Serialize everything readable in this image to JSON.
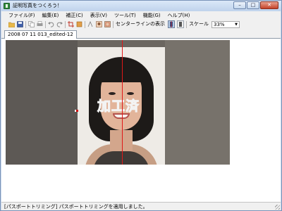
{
  "window": {
    "title": "証明写真をつくろう！",
    "controls": {
      "minimize": "–",
      "maximize": "□",
      "close": "✕"
    }
  },
  "menu": [
    {
      "label": "ファイル(F)"
    },
    {
      "label": "編集(E)"
    },
    {
      "label": "補正(C)"
    },
    {
      "label": "表示(V)"
    },
    {
      "label": "ツール(T)"
    },
    {
      "label": "機能(G)"
    },
    {
      "label": "ヘルプ(H)"
    }
  ],
  "toolbar": {
    "icons": [
      "open-folder-icon",
      "save-icon",
      "copy-icon",
      "print-icon",
      "undo-icon",
      "redo-icon",
      "crop-icon",
      "rotate-icon",
      "compare-icon",
      "image-toggle-icon",
      "face-guide-icon"
    ],
    "centerline_label": "センターラインの表示",
    "scale_label": "スケール",
    "scale_value": "33%"
  },
  "document": {
    "tab_label": "2008 07 11 013_edited-12"
  },
  "canvas": {
    "watermark": "加工済"
  },
  "status": {
    "text": "[パスポートトリミング] パスポートトリミングを適用しました。"
  },
  "colors": {
    "centerline": "#e01818",
    "title_bar": "#c9d9ee",
    "canvas_bg": "#6b6660"
  }
}
